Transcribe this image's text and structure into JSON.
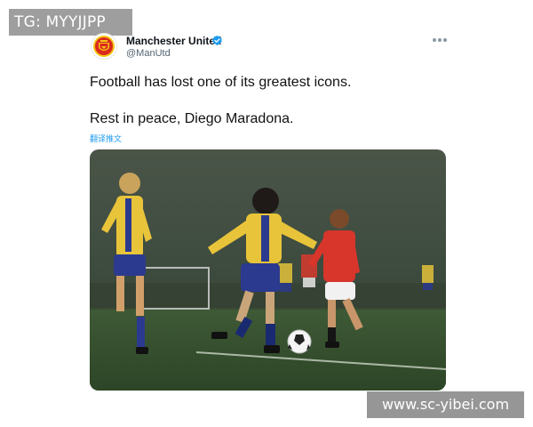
{
  "watermarks": {
    "top_left": "TG: MYYJJPP",
    "bottom_right": "www.sc-yibei.com"
  },
  "tweet": {
    "author": {
      "display_name": "Manchester United",
      "handle": "@ManUtd",
      "avatar_icon": "manchester-united-crest-icon",
      "verified_icon": "verified-badge-icon",
      "verified_color": "#1d9bf0"
    },
    "more_icon": "more-options-icon",
    "text_line_1": "Football has lost one of its greatest icons.",
    "text_line_2": "Rest in peace, Diego Maradona.",
    "translate_link": "翻译推文",
    "colors": {
      "text": "#111111",
      "secondary": "#536471",
      "link": "#1d9bf0"
    }
  }
}
